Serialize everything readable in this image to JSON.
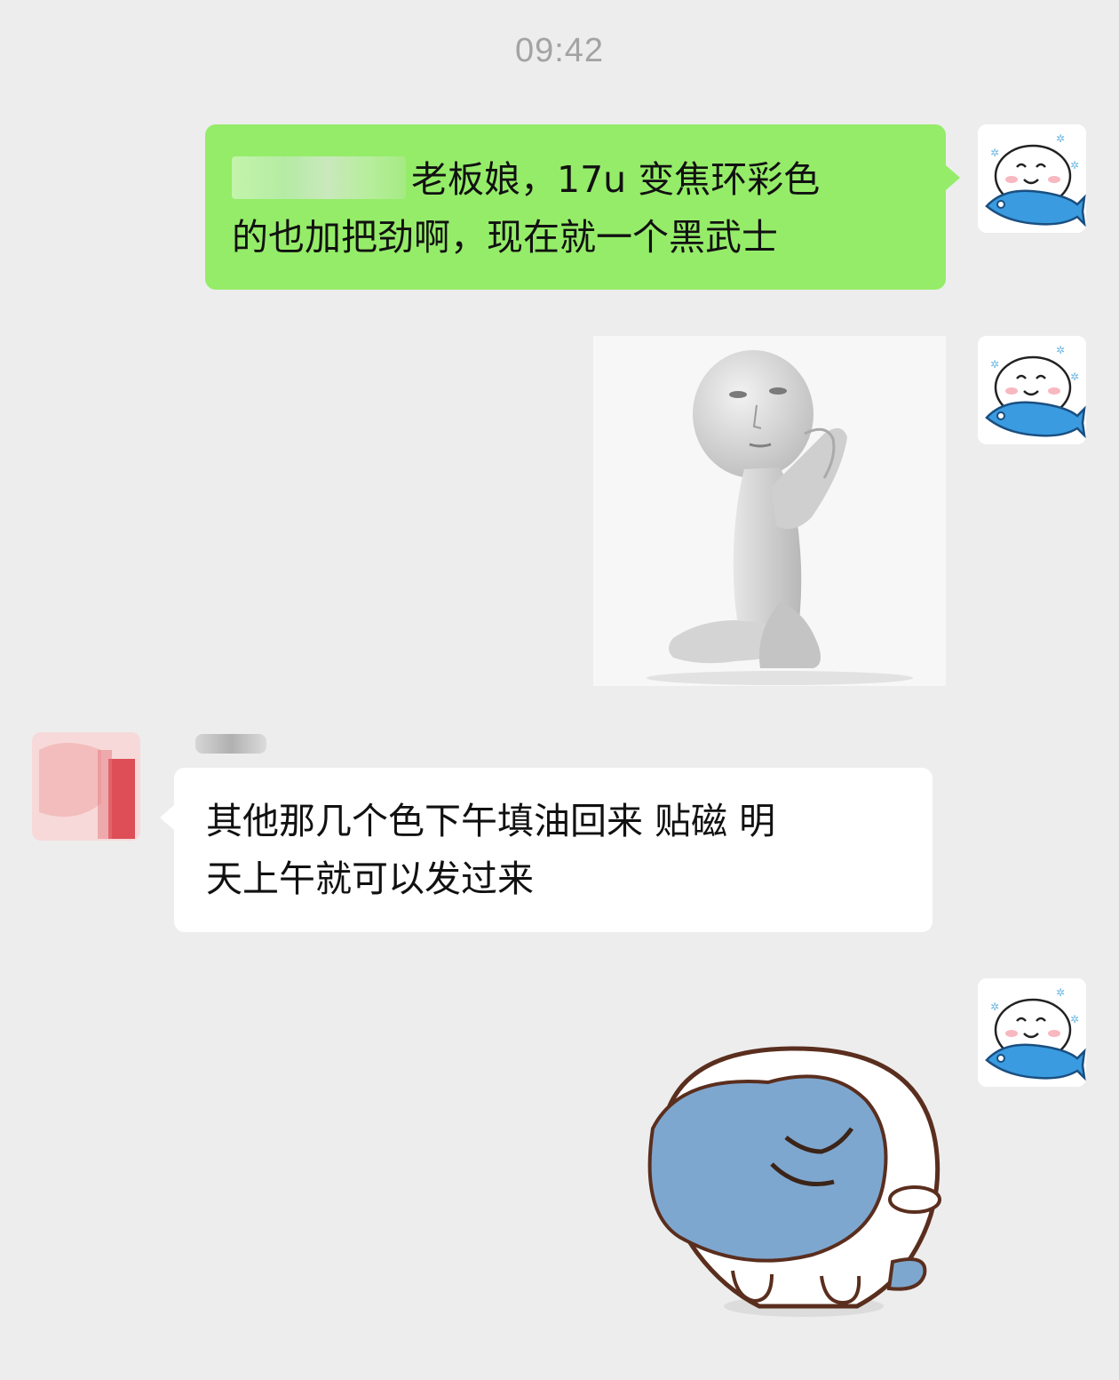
{
  "chat": {
    "timestamp": "09:42",
    "messages": [
      {
        "sender": "me",
        "type": "text",
        "line1": "老板娘，17u 变焦环彩色",
        "line2": "的也加把劲啊，现在就一个黑武士"
      },
      {
        "sender": "me",
        "type": "sticker",
        "sticker_name": "kneeling-praying-figure"
      },
      {
        "sender": "other",
        "type": "text",
        "line1": "其他那几个色下午填油回来 贴磁 明",
        "line2": "天上午就可以发过来"
      },
      {
        "sender": "me",
        "type": "sticker",
        "sticker_name": "shy-blue-blob-character"
      }
    ]
  },
  "colors": {
    "background": "#ededed",
    "my_bubble": "#95ec69",
    "their_bubble": "#ffffff",
    "timestamp_text": "#a3a3a3"
  },
  "icons": {
    "my_avatar": "smiling-bun-on-fish-icon",
    "their_avatar": "blurred-red-avatar"
  }
}
